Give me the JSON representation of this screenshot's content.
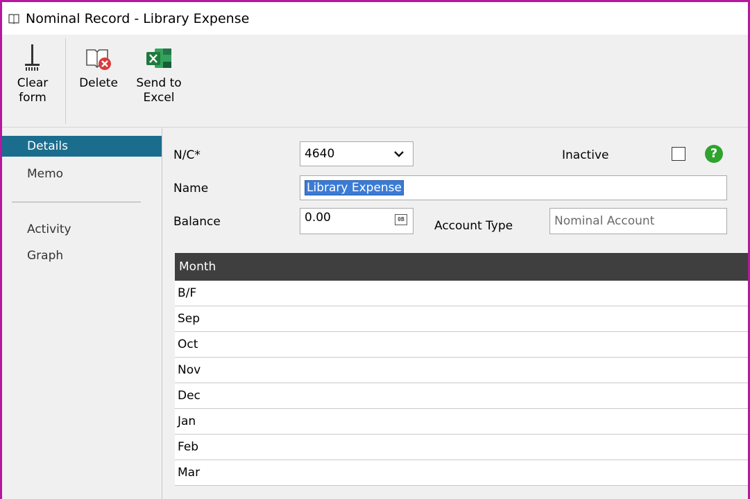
{
  "window": {
    "title": "Nominal Record - Library Expense"
  },
  "ribbon": {
    "clear_form": "Clear\nform",
    "delete": "Delete",
    "send_to_excel": "Send to\nExcel"
  },
  "nav": {
    "items": [
      "Details",
      "Memo",
      "Activity",
      "Graph"
    ],
    "active": "Details"
  },
  "form": {
    "nc_label": "N/C*",
    "nc_value": "4640",
    "inactive_label": "Inactive",
    "inactive_checked": false,
    "name_label": "Name",
    "name_value": "Library Expense",
    "balance_label": "Balance",
    "balance_value": "0.00",
    "account_type_label": "Account Type",
    "account_type_value": "Nominal Account"
  },
  "grid": {
    "header": "Month",
    "rows": [
      "B/F",
      "Sep",
      "Oct",
      "Nov",
      "Dec",
      "Jan",
      "Feb",
      "Mar"
    ]
  },
  "colors": {
    "window_border": "#b5179e",
    "nav_active": "#1b6d8e",
    "grid_header": "#3f3f3f",
    "help_icon": "#2ea32e",
    "excel_green": "#1f7a3d"
  }
}
